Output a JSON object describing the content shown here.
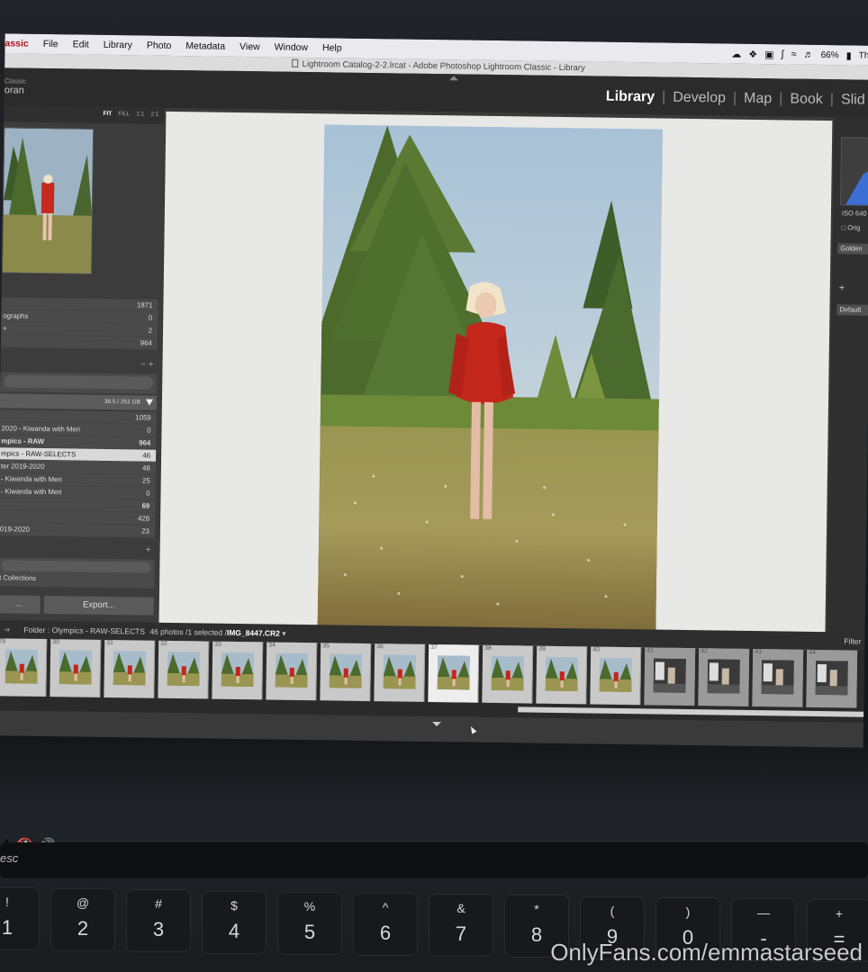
{
  "menubar": {
    "app": "assic",
    "items": [
      "File",
      "Edit",
      "Library",
      "Photo",
      "Metadata",
      "View",
      "Window",
      "Help"
    ],
    "battery": "66%",
    "clock_fragment": "Th",
    "icons": [
      "creative-cloud-icon",
      "dropbox-icon",
      "s-icon",
      "bluetooth-icon",
      "wifi-icon",
      "volume-icon",
      "battery-icon"
    ]
  },
  "window_title": "Lightroom Catalog-2-2.lrcat - Adobe Photoshop Lightroom Classic - Library",
  "identity": {
    "line1": "Classic",
    "line2": "oran"
  },
  "modules": [
    "Library",
    "Develop",
    "Map",
    "Book",
    "Slid"
  ],
  "active_module": "Library",
  "navigator": {
    "options": [
      "FIT",
      "FILL",
      "1:1",
      "2:1"
    ]
  },
  "catalog": [
    {
      "label": "",
      "count": "1871"
    },
    {
      "label": "ographs",
      "count": "0"
    },
    {
      "label": "+",
      "count": "2"
    },
    {
      "label": "",
      "count": "964"
    }
  ],
  "volume": {
    "label": "38.5 / 251 GB"
  },
  "folders": [
    {
      "label": "",
      "count": "1059",
      "bold": false
    },
    {
      "label": "2020 - Kiwanda with Meri",
      "count": "0",
      "bold": false
    },
    {
      "label": "mpics - RAW",
      "count": "964",
      "bold": true
    },
    {
      "label": "mpics - RAW-SELECTS",
      "count": "46",
      "bold": false,
      "selected": true
    },
    {
      "label": "ter 2019-2020",
      "count": "48",
      "bold": false
    },
    {
      "label": "- Kiwanda with Meri",
      "count": "25",
      "bold": false
    },
    {
      "label": "- Kiwanda with Meri",
      "count": "0",
      "bold": false
    },
    {
      "label": "",
      "count": "69",
      "bold": true
    },
    {
      "label": "",
      "count": "428",
      "bold": false
    },
    {
      "label": "019-2020",
      "count": "23",
      "bold": false
    }
  ],
  "collections": {
    "label": "t Collections"
  },
  "buttons": {
    "import": "...",
    "export": "Export..."
  },
  "right_panel": {
    "iso": "ISO 640",
    "orig": "Orig",
    "preset1": "Golden",
    "preset2": "Default"
  },
  "filmstrip": {
    "breadcrumb": "Folder : Olympics - RAW-SELECTS",
    "count_prefix": "46 photos /1 selected /",
    "filename": "IMG_8447.CR2",
    "filter": "Filter",
    "numbers": [
      "29",
      "30",
      "31",
      "32",
      "33",
      "34",
      "35",
      "36",
      "37",
      "38",
      "39",
      "40",
      "41",
      "42",
      "43",
      "44"
    ],
    "selected_number": "37"
  },
  "keyboard": {
    "esc": "esc",
    "keys": [
      {
        "top": "!",
        "bottom": "1"
      },
      {
        "top": "@",
        "bottom": "2"
      },
      {
        "top": "#",
        "bottom": "3"
      },
      {
        "top": "$",
        "bottom": "4"
      },
      {
        "top": "%",
        "bottom": "5"
      },
      {
        "top": "^",
        "bottom": "6"
      },
      {
        "top": "&",
        "bottom": "7"
      },
      {
        "top": "*",
        "bottom": "8"
      },
      {
        "top": "(",
        "bottom": "9"
      },
      {
        "top": ")",
        "bottom": "0"
      },
      {
        "top": "—",
        "bottom": "-"
      },
      {
        "top": "+",
        "bottom": "="
      }
    ]
  },
  "watermark": "OnlyFans.com/emmastarseed"
}
